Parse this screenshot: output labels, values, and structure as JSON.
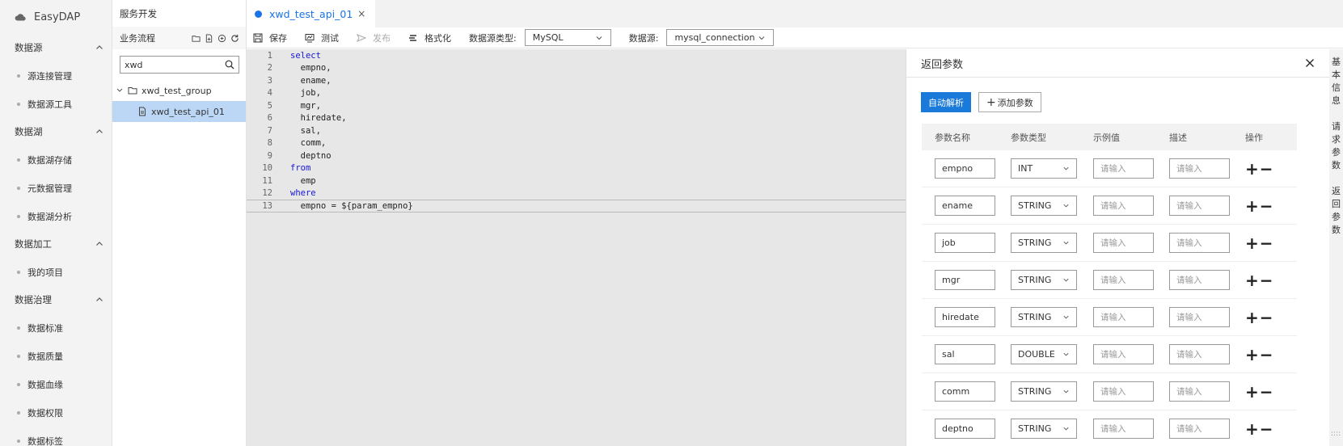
{
  "app": {
    "name": "EasyDAP"
  },
  "sidebar": {
    "groups": [
      {
        "title": "数据源",
        "items": [
          "源连接管理",
          "数据源工具"
        ]
      },
      {
        "title": "数据湖",
        "items": [
          "数据湖存储",
          "元数据管理",
          "数据湖分析"
        ]
      },
      {
        "title": "数据加工",
        "items": [
          "我的项目"
        ]
      },
      {
        "title": "数据治理",
        "items": [
          "数据标准",
          "数据质量",
          "数据血缘",
          "数据权限",
          "数据标签"
        ]
      }
    ]
  },
  "tree": {
    "title": "服务开发",
    "section": "业务流程",
    "search_value": "xwd",
    "group": "xwd_test_group",
    "item": "xwd_test_api_01"
  },
  "tab": {
    "label": "xwd_test_api_01",
    "close": "×"
  },
  "toolbar": {
    "save": "保存",
    "test": "测试",
    "publish": "发布",
    "format": "格式化",
    "ds_type_label": "数据源类型:",
    "ds_type_value": "MySQL",
    "ds_label": "数据源:",
    "ds_value": "mysql_connection"
  },
  "editor": {
    "lines": [
      {
        "n": "1",
        "code": "select",
        "kw": true
      },
      {
        "n": "2",
        "code": "  empno,",
        "kw": false
      },
      {
        "n": "3",
        "code": "  ename,",
        "kw": false
      },
      {
        "n": "4",
        "code": "  job,",
        "kw": false
      },
      {
        "n": "5",
        "code": "  mgr,",
        "kw": false
      },
      {
        "n": "6",
        "code": "  hiredate,",
        "kw": false
      },
      {
        "n": "7",
        "code": "  sal,",
        "kw": false
      },
      {
        "n": "8",
        "code": "  comm,",
        "kw": false
      },
      {
        "n": "9",
        "code": "  deptno",
        "kw": false
      },
      {
        "n": "10",
        "code": "from",
        "kw": true
      },
      {
        "n": "11",
        "code": "  emp",
        "kw": false
      },
      {
        "n": "12",
        "code": "where",
        "kw": true
      },
      {
        "n": "13",
        "code": "  empno = ${param_empno}",
        "kw": false
      }
    ]
  },
  "panel": {
    "title": "返回参数",
    "auto_parse": "自动解析",
    "add_param": "添加参数",
    "columns": [
      "参数名称",
      "参数类型",
      "示例值",
      "描述",
      "操作"
    ],
    "placeholder": "请输入",
    "rows": [
      {
        "name": "empno",
        "type": "INT"
      },
      {
        "name": "ename",
        "type": "STRING"
      },
      {
        "name": "job",
        "type": "STRING"
      },
      {
        "name": "mgr",
        "type": "STRING"
      },
      {
        "name": "hiredate",
        "type": "STRING"
      },
      {
        "name": "sal",
        "type": "DOUBLE"
      },
      {
        "name": "comm",
        "type": "STRING"
      },
      {
        "name": "deptno",
        "type": "STRING"
      }
    ],
    "plus": "+",
    "minus": "−"
  },
  "right_tabs": [
    "基本信息",
    "请求参数",
    "返回参数"
  ],
  "colors": {
    "accent": "#1a7ad9",
    "selected_row": "#bcd7f5",
    "keyword": "#1717d6"
  }
}
